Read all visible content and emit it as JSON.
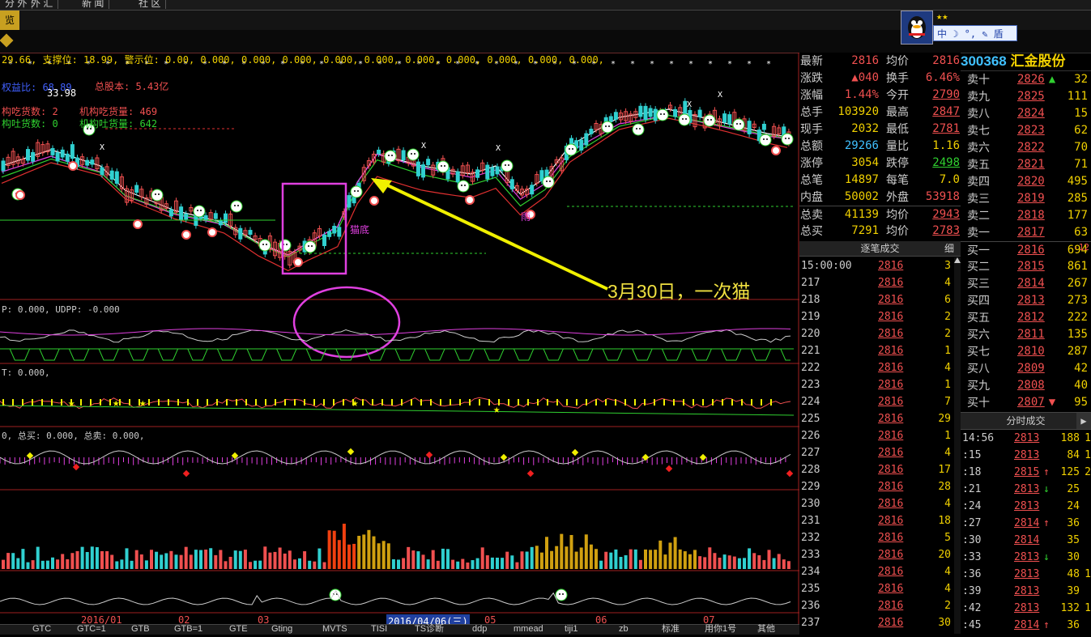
{
  "top_tabs": [
    "分 外",
    "外 汇",
    "新 闻",
    "社 区"
  ],
  "left_tab": "览",
  "qq": {
    "stars": "★★",
    "bar": "中 ☽ °, ✎ 盾"
  },
  "stock": {
    "code": "300368",
    "name": "汇金股份"
  },
  "main_chart": {
    "indicator_line": "29.66, 支撑位: 18.99, 警示位: 0.00, 0.000, 0.000, 0.000, 0.000, 0.000, 0.000, 0.000, 0.000, 0.000, 0.000,",
    "support_label": "支撑位",
    "warn_label": "警示位",
    "label_quanyi": "权益比: 68.89",
    "label_3398": "33.98",
    "label_zongguben": "总股本: 5.43亿",
    "label_jigouchi": "构吃货数: 2",
    "label_jigoutu": "构吐货数: 0",
    "label_jigouchi_l": "机构吃货量: 469",
    "label_jigoutu_l": "机构吐货量: 642",
    "annotation": "3月30日，一次猫",
    "label_maodi": "猫底",
    "label_yushi": "雨"
  },
  "sub1_label": "P: 0.000, UDPP: -0.000",
  "sub2_label": "T: 0.000,",
  "sub3_label": "0, 总买: 0.000, 总卖: 0.000,",
  "date_axis": [
    "2016/01",
    "02",
    "03",
    "2016/04/06(三)",
    "05",
    "06",
    "07"
  ],
  "bottom_tabs": [
    "GTC",
    "GTC=1",
    "GTB",
    "GTB=1",
    "GTE",
    "Gting",
    "MVTS",
    "TISI",
    "TS诊断",
    "ddp",
    "mmead",
    "tiji1",
    "zb",
    "标准",
    "用你1号",
    "其他"
  ],
  "quote": [
    {
      "l": "最新",
      "v1": "2816",
      "l2": "均价",
      "v2": "2816"
    },
    {
      "l": "涨跌",
      "v1": "▲040",
      "l2": "换手",
      "v2": "6.46%"
    },
    {
      "l": "涨幅",
      "v1": "1.44%",
      "l2": "今开",
      "v2": "2790"
    },
    {
      "l": "总手",
      "v1": "103920",
      "l2": "最高",
      "v2": "2847"
    },
    {
      "l": "现手",
      "v1": "2032",
      "l2": "最低",
      "v2": "2781"
    },
    {
      "l": "总额",
      "v1": "29266",
      "l2": "量比",
      "v2": "1.16"
    },
    {
      "l": "涨停",
      "v1": "3054",
      "l2": "跌停",
      "v2": "2498"
    },
    {
      "l": "总笔",
      "v1": "14897",
      "l2": "每笔",
      "v2": "7.0"
    },
    {
      "l": "内盘",
      "v1": "50002",
      "l2": "外盘",
      "v2": "53918"
    },
    {
      "l": "总卖",
      "v1": "41139",
      "l2": "均价",
      "v2": "2943"
    },
    {
      "l": "总买",
      "v1": "7291",
      "l2": "均价",
      "v2": "2783"
    }
  ],
  "ticks_title": "逐笔成交",
  "ticks_btn": "细",
  "ticks": [
    {
      "t": "15:00:00",
      "p": "2816",
      "v": "3"
    },
    {
      "t": "217",
      "p": "2816",
      "v": "4"
    },
    {
      "t": "218",
      "p": "2816",
      "v": "6"
    },
    {
      "t": "219",
      "p": "2816",
      "v": "2"
    },
    {
      "t": "220",
      "p": "2816",
      "v": "2"
    },
    {
      "t": "221",
      "p": "2816",
      "v": "1"
    },
    {
      "t": "222",
      "p": "2816",
      "v": "4"
    },
    {
      "t": "223",
      "p": "2816",
      "v": "1"
    },
    {
      "t": "224",
      "p": "2816",
      "v": "7"
    },
    {
      "t": "225",
      "p": "2816",
      "v": "29"
    },
    {
      "t": "226",
      "p": "2816",
      "v": "1"
    },
    {
      "t": "227",
      "p": "2816",
      "v": "4"
    },
    {
      "t": "228",
      "p": "2816",
      "v": "17"
    },
    {
      "t": "229",
      "p": "2816",
      "v": "28"
    },
    {
      "t": "230",
      "p": "2816",
      "v": "4"
    },
    {
      "t": "231",
      "p": "2816",
      "v": "18"
    },
    {
      "t": "232",
      "p": "2816",
      "v": "5"
    },
    {
      "t": "233",
      "p": "2816",
      "v": "20"
    },
    {
      "t": "234",
      "p": "2816",
      "v": "4"
    },
    {
      "t": "235",
      "p": "2816",
      "v": "4"
    },
    {
      "t": "236",
      "p": "2816",
      "v": "2"
    },
    {
      "t": "237",
      "p": "2816",
      "v": "30"
    }
  ],
  "orders": [
    {
      "l": "卖十",
      "p": "2826",
      "a": "▲",
      "ac": "#30d030",
      "v": "32",
      "e": ""
    },
    {
      "l": "卖九",
      "p": "2825",
      "a": "",
      "ac": "",
      "v": "111",
      "e": ""
    },
    {
      "l": "卖八",
      "p": "2824",
      "a": "",
      "ac": "",
      "v": "15",
      "e": ""
    },
    {
      "l": "卖七",
      "p": "2823",
      "a": "",
      "ac": "",
      "v": "62",
      "e": ""
    },
    {
      "l": "卖六",
      "p": "2822",
      "a": "",
      "ac": "",
      "v": "70",
      "e": ""
    },
    {
      "l": "卖五",
      "p": "2821",
      "a": "",
      "ac": "",
      "v": "71",
      "e": ""
    },
    {
      "l": "卖四",
      "p": "2820",
      "a": "",
      "ac": "",
      "v": "495",
      "e": ""
    },
    {
      "l": "卖三",
      "p": "2819",
      "a": "",
      "ac": "",
      "v": "285",
      "e": ""
    },
    {
      "l": "卖二",
      "p": "2818",
      "a": "",
      "ac": "",
      "v": "177",
      "e": ""
    },
    {
      "l": "卖一",
      "p": "2817",
      "a": "",
      "ac": "",
      "v": "63",
      "e": ""
    },
    {
      "l": "买一",
      "p": "2816",
      "a": "",
      "ac": "",
      "v": "694",
      "e": "-12"
    },
    {
      "l": "买二",
      "p": "2815",
      "a": "",
      "ac": "",
      "v": "861",
      "e": ""
    },
    {
      "l": "买三",
      "p": "2814",
      "a": "",
      "ac": "",
      "v": "267",
      "e": ""
    },
    {
      "l": "买四",
      "p": "2813",
      "a": "",
      "ac": "",
      "v": "273",
      "e": ""
    },
    {
      "l": "买五",
      "p": "2812",
      "a": "",
      "ac": "",
      "v": "222",
      "e": ""
    },
    {
      "l": "买六",
      "p": "2811",
      "a": "",
      "ac": "",
      "v": "135",
      "e": ""
    },
    {
      "l": "买七",
      "p": "2810",
      "a": "",
      "ac": "",
      "v": "287",
      "e": ""
    },
    {
      "l": "买八",
      "p": "2809",
      "a": "",
      "ac": "",
      "v": "42",
      "e": ""
    },
    {
      "l": "买九",
      "p": "2808",
      "a": "",
      "ac": "",
      "v": "40",
      "e": ""
    },
    {
      "l": "买十",
      "p": "2807",
      "a": "▼",
      "ac": "#f05050",
      "v": "95",
      "e": ""
    }
  ],
  "fs_title": "分时成交",
  "fs": [
    {
      "t": "14:56",
      "p": "2813",
      "a": "",
      "ac": "",
      "v": "188",
      "e": "1"
    },
    {
      "t": ":15",
      "p": "2813",
      "a": "",
      "ac": "",
      "v": "84",
      "e": "1"
    },
    {
      "t": ":18",
      "p": "2815",
      "a": "↑",
      "ac": "#f05050",
      "v": "125",
      "e": "2"
    },
    {
      "t": ":21",
      "p": "2813",
      "a": "↓",
      "ac": "#30d030",
      "v": "25",
      "e": ""
    },
    {
      "t": ":24",
      "p": "2813",
      "a": "",
      "ac": "",
      "v": "24",
      "e": ""
    },
    {
      "t": ":27",
      "p": "2814",
      "a": "↑",
      "ac": "#f05050",
      "v": "36",
      "e": ""
    },
    {
      "t": ":30",
      "p": "2814",
      "a": "",
      "ac": "",
      "v": "35",
      "e": ""
    },
    {
      "t": ":33",
      "p": "2813",
      "a": "↓",
      "ac": "#30d030",
      "v": "30",
      "e": ""
    },
    {
      "t": ":36",
      "p": "2813",
      "a": "",
      "ac": "",
      "v": "48",
      "e": "1"
    },
    {
      "t": ":39",
      "p": "2813",
      "a": "",
      "ac": "",
      "v": "39",
      "e": ""
    },
    {
      "t": ":42",
      "p": "2813",
      "a": "",
      "ac": "",
      "v": "132",
      "e": "1"
    },
    {
      "t": ":45",
      "p": "2814",
      "a": "↑",
      "ac": "#f05050",
      "v": "36",
      "e": ""
    }
  ],
  "colors": {
    "up": "#f05050",
    "down": "#30d030",
    "volume": "#f0d000",
    "accent": "#e040e0",
    "annotation": "#f0e040"
  }
}
